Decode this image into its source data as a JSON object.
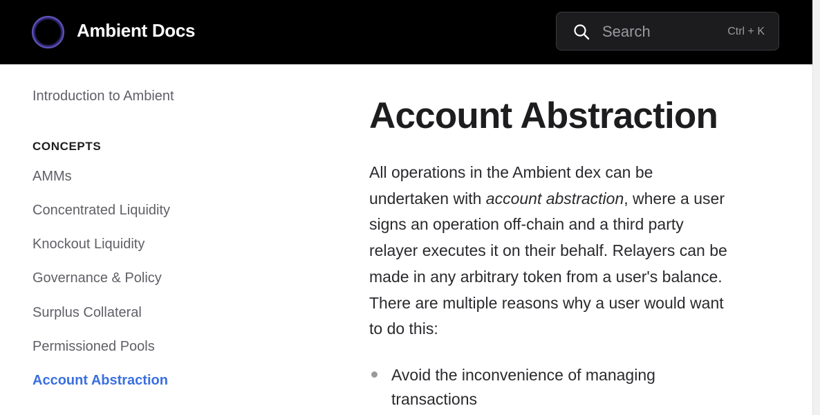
{
  "header": {
    "brand": "Ambient Docs",
    "search": {
      "placeholder": "Search",
      "shortcut": "Ctrl + K"
    }
  },
  "sidebar": {
    "intro": "Introduction to Ambient",
    "section_label": "CONCEPTS",
    "items": [
      {
        "label": "AMMs"
      },
      {
        "label": "Concentrated Liquidity"
      },
      {
        "label": "Knockout Liquidity"
      },
      {
        "label": "Governance & Policy"
      },
      {
        "label": "Surplus Collateral"
      },
      {
        "label": "Permissioned Pools"
      },
      {
        "label": "Account Abstraction",
        "active": true
      }
    ]
  },
  "main": {
    "title": "Account Abstraction",
    "para_before": "All operations in the Ambient dex can be undertaken with ",
    "para_emphasis": "account abstraction",
    "para_after": ", where a user signs an operation off-chain and a third party relayer executes it on their behalf. Relayers can be made in any arbitrary token from a user's balance. There are multiple reasons why a user would want to do this:",
    "bullets": [
      "Avoid the inconvenience of managing transactions"
    ]
  },
  "colors": {
    "header_bg": "#000000",
    "accent": "#3a6fe0",
    "sidebar_text": "#5f5f66",
    "body_text": "#2a2a2e"
  },
  "icons": {
    "logo": "ambient-logo",
    "search": "search-icon"
  }
}
